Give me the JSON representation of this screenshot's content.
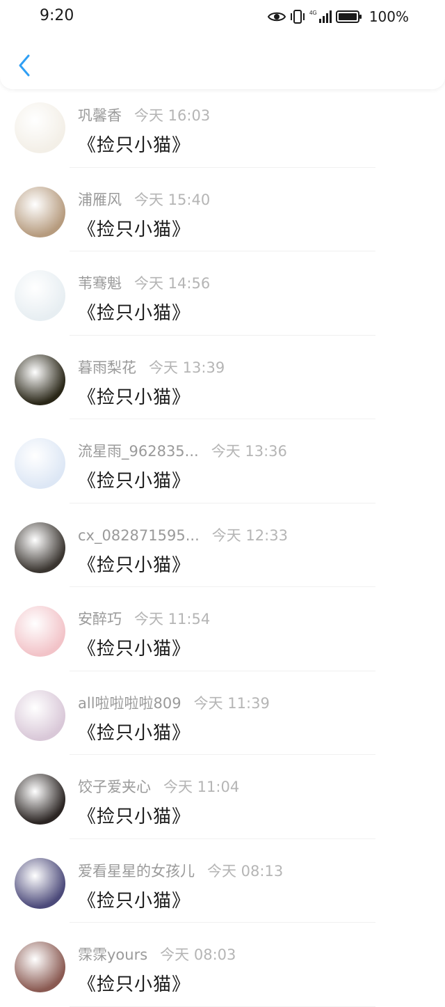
{
  "status_bar": {
    "time": "9:20",
    "battery_percent": "100%",
    "network": "4G"
  },
  "header": {
    "back_icon": "chevron-left-icon",
    "accent_color": "#2f9ff4"
  },
  "comments": [
    {
      "name": "巩馨香",
      "time": "今天 16:03",
      "message": "《捡只小猫》",
      "avatar_color": "#f3efe7"
    },
    {
      "name": "浦雁风",
      "time": "今天 15:40",
      "message": "《捡只小猫》",
      "avatar_color": "#b69b7e"
    },
    {
      "name": "苇骞魁",
      "time": "今天 14:56",
      "message": "《捡只小猫》",
      "avatar_color": "#e7eef2"
    },
    {
      "name": "暮雨梨花",
      "time": "今天 13:39",
      "message": "《捡只小猫》",
      "avatar_color": "#2a2718"
    },
    {
      "name": "流星雨_962835...",
      "time": "今天 13:36",
      "message": "《捡只小猫》",
      "avatar_color": "#dde7f5"
    },
    {
      "name": "cx_082871595...",
      "time": "今天 12:33",
      "message": "《捡只小猫》",
      "avatar_color": "#3a3530"
    },
    {
      "name": "安醉巧",
      "time": "今天 11:54",
      "message": "《捡只小猫》",
      "avatar_color": "#f2c3c8"
    },
    {
      "name": "all啦啦啦啦809",
      "time": "今天 11:39",
      "message": "《捡只小猫》",
      "avatar_color": "#d9c8d8"
    },
    {
      "name": "饺子爱夹心",
      "time": "今天 11:04",
      "message": "《捡只小猫》",
      "avatar_color": "#2b2523"
    },
    {
      "name": "爱看星星的女孩儿",
      "time": "今天 08:13",
      "message": "《捡只小猫》",
      "avatar_color": "#4c4a7a"
    },
    {
      "name": "霂霂yours",
      "time": "今天 08:03",
      "message": "《捡只小猫》",
      "avatar_color": "#8a5a52"
    }
  ]
}
